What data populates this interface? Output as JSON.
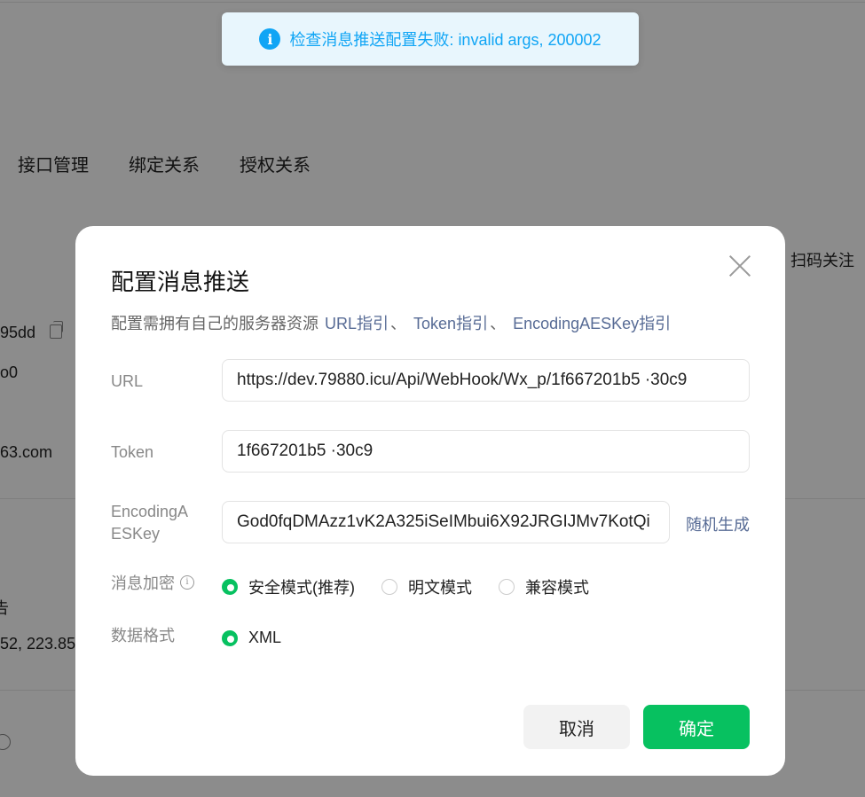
{
  "background": {
    "tabs": [
      "接口管理",
      "绑定关系",
      "授权关系"
    ],
    "right_link": "扫码关注",
    "fragments": [
      "95dd",
      "o0",
      "63.com",
      "告",
      "52, 223.85."
    ]
  },
  "toast": {
    "icon": "info-icon",
    "message": "检查消息推送配置失败: invalid args, 200002",
    "color": "#10a5f5"
  },
  "modal": {
    "title": "配置消息推送",
    "description": "配置需拥有自己的服务器资源",
    "links": [
      "URL指引",
      "Token指引",
      "EncodingAESKey指引"
    ],
    "link_separator": "、",
    "fields": {
      "url": {
        "label": "URL",
        "value": "https://dev.79880.icu/Api/WebHook/Wx_p/1f667201b5 ·30c9"
      },
      "token": {
        "label": "Token",
        "value": "1f667201b5 ·30c9"
      },
      "aes_key": {
        "label": "EncodingAESKey",
        "value": "God0fqDMAzz1vK2A325iSeIMbui6X92JRGIJMv7KotQi",
        "generate_label": "随机生成"
      }
    },
    "encryption": {
      "label": "消息加密",
      "options": [
        {
          "label": "安全模式(推荐)",
          "checked": true
        },
        {
          "label": "明文模式",
          "checked": false
        },
        {
          "label": "兼容模式",
          "checked": false
        }
      ]
    },
    "format": {
      "label": "数据格式",
      "options": [
        {
          "label": "XML",
          "checked": true
        }
      ]
    },
    "cancel_label": "取消",
    "confirm_label": "确定",
    "accent_color": "#07c160",
    "link_color": "#576b95"
  }
}
